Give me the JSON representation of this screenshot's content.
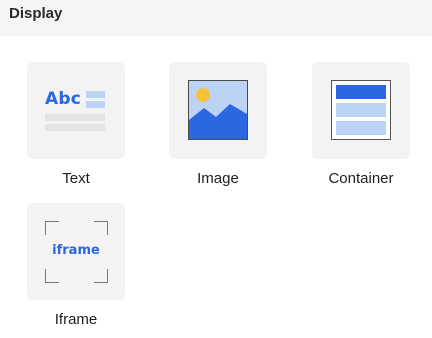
{
  "section": {
    "title": "Display"
  },
  "components": [
    {
      "label": "Text",
      "icon": "text-abc-icon",
      "icon_text": "Abc"
    },
    {
      "label": "Image",
      "icon": "image-landscape-icon"
    },
    {
      "label": "Container",
      "icon": "container-layout-icon"
    },
    {
      "label": "Iframe",
      "icon": "iframe-icon",
      "icon_text": "iframe"
    }
  ],
  "colors": {
    "accent": "#2a67e0",
    "accent_light": "#bcd3f5",
    "tile_bg": "#f3f3f3",
    "header_bg": "#f5f5f5",
    "sun": "#f5c23a"
  }
}
